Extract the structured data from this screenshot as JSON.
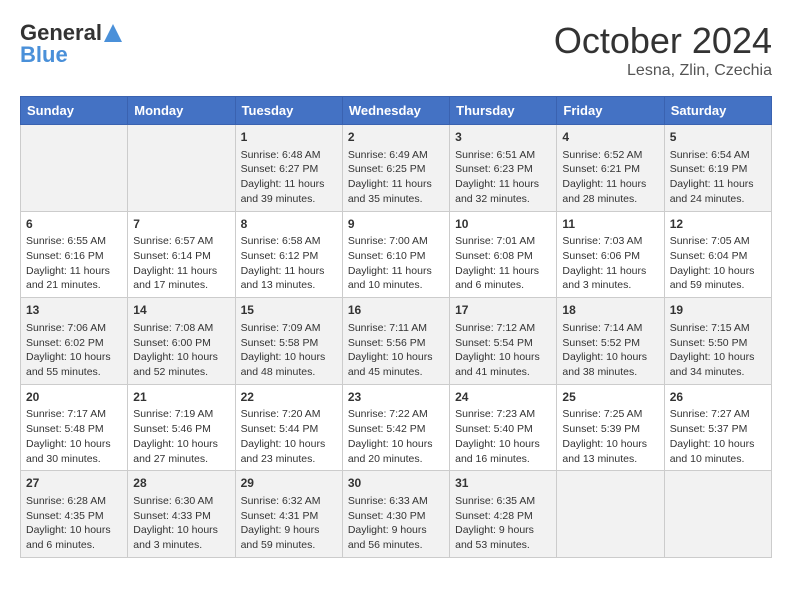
{
  "logo": {
    "general": "General",
    "blue": "Blue"
  },
  "title": "October 2024",
  "location": "Lesna, Zlin, Czechia",
  "days_of_week": [
    "Sunday",
    "Monday",
    "Tuesday",
    "Wednesday",
    "Thursday",
    "Friday",
    "Saturday"
  ],
  "weeks": [
    [
      {
        "day": "",
        "content": ""
      },
      {
        "day": "",
        "content": ""
      },
      {
        "day": "1",
        "content": "Sunrise: 6:48 AM\nSunset: 6:27 PM\nDaylight: 11 hours and 39 minutes."
      },
      {
        "day": "2",
        "content": "Sunrise: 6:49 AM\nSunset: 6:25 PM\nDaylight: 11 hours and 35 minutes."
      },
      {
        "day": "3",
        "content": "Sunrise: 6:51 AM\nSunset: 6:23 PM\nDaylight: 11 hours and 32 minutes."
      },
      {
        "day": "4",
        "content": "Sunrise: 6:52 AM\nSunset: 6:21 PM\nDaylight: 11 hours and 28 minutes."
      },
      {
        "day": "5",
        "content": "Sunrise: 6:54 AM\nSunset: 6:19 PM\nDaylight: 11 hours and 24 minutes."
      }
    ],
    [
      {
        "day": "6",
        "content": "Sunrise: 6:55 AM\nSunset: 6:16 PM\nDaylight: 11 hours and 21 minutes."
      },
      {
        "day": "7",
        "content": "Sunrise: 6:57 AM\nSunset: 6:14 PM\nDaylight: 11 hours and 17 minutes."
      },
      {
        "day": "8",
        "content": "Sunrise: 6:58 AM\nSunset: 6:12 PM\nDaylight: 11 hours and 13 minutes."
      },
      {
        "day": "9",
        "content": "Sunrise: 7:00 AM\nSunset: 6:10 PM\nDaylight: 11 hours and 10 minutes."
      },
      {
        "day": "10",
        "content": "Sunrise: 7:01 AM\nSunset: 6:08 PM\nDaylight: 11 hours and 6 minutes."
      },
      {
        "day": "11",
        "content": "Sunrise: 7:03 AM\nSunset: 6:06 PM\nDaylight: 11 hours and 3 minutes."
      },
      {
        "day": "12",
        "content": "Sunrise: 7:05 AM\nSunset: 6:04 PM\nDaylight: 10 hours and 59 minutes."
      }
    ],
    [
      {
        "day": "13",
        "content": "Sunrise: 7:06 AM\nSunset: 6:02 PM\nDaylight: 10 hours and 55 minutes."
      },
      {
        "day": "14",
        "content": "Sunrise: 7:08 AM\nSunset: 6:00 PM\nDaylight: 10 hours and 52 minutes."
      },
      {
        "day": "15",
        "content": "Sunrise: 7:09 AM\nSunset: 5:58 PM\nDaylight: 10 hours and 48 minutes."
      },
      {
        "day": "16",
        "content": "Sunrise: 7:11 AM\nSunset: 5:56 PM\nDaylight: 10 hours and 45 minutes."
      },
      {
        "day": "17",
        "content": "Sunrise: 7:12 AM\nSunset: 5:54 PM\nDaylight: 10 hours and 41 minutes."
      },
      {
        "day": "18",
        "content": "Sunrise: 7:14 AM\nSunset: 5:52 PM\nDaylight: 10 hours and 38 minutes."
      },
      {
        "day": "19",
        "content": "Sunrise: 7:15 AM\nSunset: 5:50 PM\nDaylight: 10 hours and 34 minutes."
      }
    ],
    [
      {
        "day": "20",
        "content": "Sunrise: 7:17 AM\nSunset: 5:48 PM\nDaylight: 10 hours and 30 minutes."
      },
      {
        "day": "21",
        "content": "Sunrise: 7:19 AM\nSunset: 5:46 PM\nDaylight: 10 hours and 27 minutes."
      },
      {
        "day": "22",
        "content": "Sunrise: 7:20 AM\nSunset: 5:44 PM\nDaylight: 10 hours and 23 minutes."
      },
      {
        "day": "23",
        "content": "Sunrise: 7:22 AM\nSunset: 5:42 PM\nDaylight: 10 hours and 20 minutes."
      },
      {
        "day": "24",
        "content": "Sunrise: 7:23 AM\nSunset: 5:40 PM\nDaylight: 10 hours and 16 minutes."
      },
      {
        "day": "25",
        "content": "Sunrise: 7:25 AM\nSunset: 5:39 PM\nDaylight: 10 hours and 13 minutes."
      },
      {
        "day": "26",
        "content": "Sunrise: 7:27 AM\nSunset: 5:37 PM\nDaylight: 10 hours and 10 minutes."
      }
    ],
    [
      {
        "day": "27",
        "content": "Sunrise: 6:28 AM\nSunset: 4:35 PM\nDaylight: 10 hours and 6 minutes."
      },
      {
        "day": "28",
        "content": "Sunrise: 6:30 AM\nSunset: 4:33 PM\nDaylight: 10 hours and 3 minutes."
      },
      {
        "day": "29",
        "content": "Sunrise: 6:32 AM\nSunset: 4:31 PM\nDaylight: 9 hours and 59 minutes."
      },
      {
        "day": "30",
        "content": "Sunrise: 6:33 AM\nSunset: 4:30 PM\nDaylight: 9 hours and 56 minutes."
      },
      {
        "day": "31",
        "content": "Sunrise: 6:35 AM\nSunset: 4:28 PM\nDaylight: 9 hours and 53 minutes."
      },
      {
        "day": "",
        "content": ""
      },
      {
        "day": "",
        "content": ""
      }
    ]
  ]
}
